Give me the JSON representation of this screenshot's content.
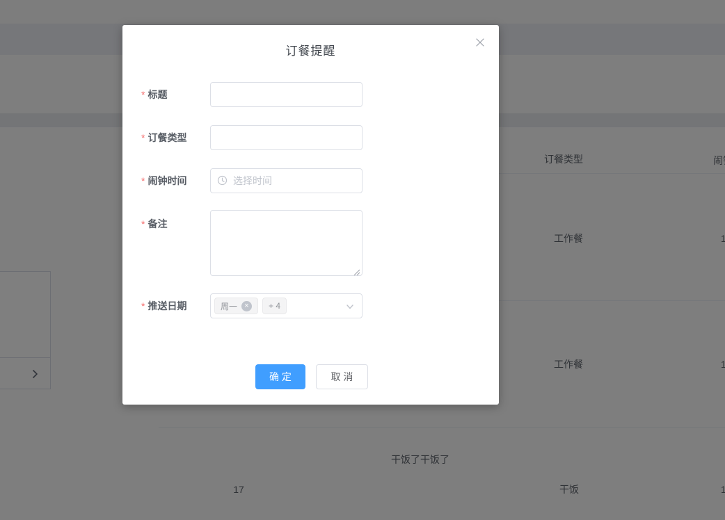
{
  "dialog": {
    "title": "订餐提醒",
    "required_mark": "*",
    "fields": {
      "title": {
        "label": "标题",
        "value": ""
      },
      "meal_type": {
        "label": "订餐类型",
        "value": ""
      },
      "alarm_time": {
        "label": "闹钟时间",
        "placeholder": "选择时间",
        "icon": "clock-icon"
      },
      "remark": {
        "label": "备注",
        "value": ""
      },
      "push_days": {
        "label": "推送日期",
        "selected_tag": "周一",
        "collapsed_tag": "+ 4",
        "remove_icon": "×",
        "dropdown_icon": "chevron-down-icon"
      }
    },
    "footer": {
      "confirm_label": "确 定",
      "cancel_label": "取 消"
    }
  },
  "background": {
    "left_panel": {
      "expand_icon": "chevron-right-icon"
    },
    "table": {
      "headers": {
        "meal_type": "订餐类型",
        "alarm_time": "闹钟"
      },
      "rows": [
        {
          "meal_type": "工作餐",
          "alarm_time": "1"
        },
        {
          "meal_type": "工作餐",
          "alarm_time": "1"
        },
        {
          "id": "17",
          "title": "干饭了干饭了",
          "meal_type": "干饭",
          "alarm_time": "1"
        }
      ]
    }
  },
  "colors": {
    "primary": "#409eff",
    "required": "#f56c6c",
    "input_border": "#dcdfe6",
    "placeholder": "#c0c4cc",
    "text": "#606266",
    "tag_bg": "#f4f4f5",
    "overlay": "rgba(0,0,0,0.5)"
  }
}
